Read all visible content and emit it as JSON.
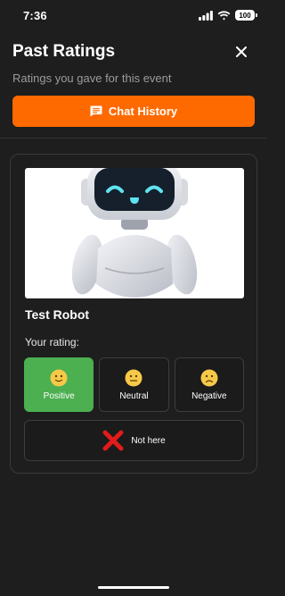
{
  "status_bar": {
    "time": "7:36",
    "battery": "100"
  },
  "header": {
    "title": "Past Ratings",
    "subtitle": "Ratings you gave for this event",
    "close_icon": "close-icon"
  },
  "chat_button": {
    "label": "Chat History",
    "icon": "chat-icon",
    "color": "#ff6a00"
  },
  "card": {
    "bot_name": "Test Robot",
    "rating_label": "Your rating:",
    "options": [
      {
        "label": "Positive",
        "icon": "slightly-smiling-face",
        "selected": true
      },
      {
        "label": "Neutral",
        "icon": "neutral-face",
        "selected": false
      },
      {
        "label": "Negative",
        "icon": "frowning-face",
        "selected": false
      }
    ],
    "not_here": {
      "label": "Not here",
      "icon": "red-cross-mark"
    }
  },
  "colors": {
    "accent": "#ff6a00",
    "selected": "#4caf50",
    "background": "#1e1e1e"
  }
}
